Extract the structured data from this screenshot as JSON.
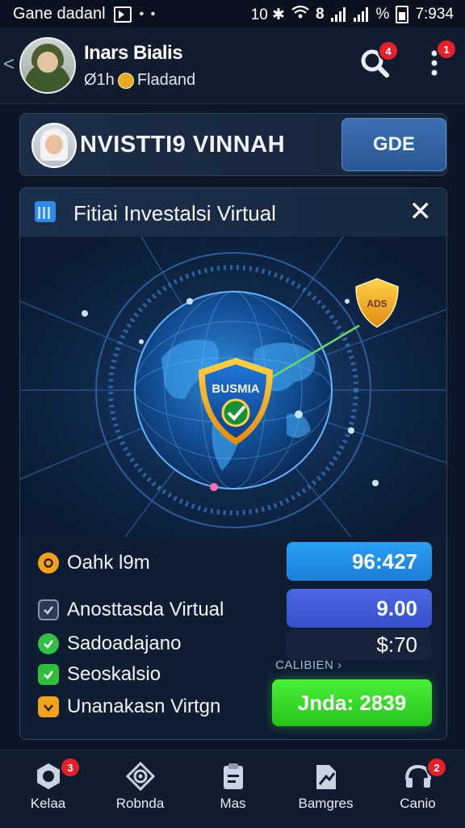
{
  "status_bar": {
    "left_text": "Gane dadanl",
    "dots": "• •",
    "indicators": "10 ✱",
    "net_label": "8",
    "percent": "%",
    "time": "7:934"
  },
  "header": {
    "user_name": "Inars Bialis",
    "user_sub_prefix": "Ø1h",
    "user_sub": "Fladand",
    "search_badge": "4",
    "menu_badge": "1"
  },
  "profile_card": {
    "title": "NVISTTI9 VINNAH",
    "button": "GDE"
  },
  "panel": {
    "title": "Fitiai Investalsi Virtual",
    "close_label": "✕",
    "shield_label": "BUSMIA",
    "small_shield_label": "ADS"
  },
  "rows": [
    {
      "label": "Oahk l9m",
      "icon": "coin-icon",
      "icon_color": "#f0a21f"
    },
    {
      "label": "Anosttasda Virtual",
      "icon": "checkbox-icon",
      "icon_color": "#8a94a8"
    },
    {
      "label": "Sadoadajano",
      "icon": "check-circle-icon",
      "icon_color": "#31c046"
    },
    {
      "label": "Seoskalsio",
      "icon": "check-box-icon",
      "icon_color": "#2fbf3a"
    },
    {
      "label": "Unanakasn Virtgn",
      "icon": "orange-check-icon",
      "icon_color": "#f0a21f"
    }
  ],
  "values": [
    {
      "text": "96:427",
      "color": "#1e8ee8"
    },
    {
      "text": "9.00",
      "color": "#3f58d6"
    },
    {
      "text": "$:70",
      "color": "#17233b"
    }
  ],
  "caption": "CALIBIEN",
  "cta_label": "Jnda: 2839",
  "bottom_nav": [
    {
      "label": "Kelaa",
      "icon": "hex-nut-icon",
      "badge": "3"
    },
    {
      "label": "Robnda",
      "icon": "target-icon",
      "badge": ""
    },
    {
      "label": "Mas",
      "icon": "clipboard-icon",
      "badge": ""
    },
    {
      "label": "Bamgres",
      "icon": "arrow-chart-icon",
      "badge": ""
    },
    {
      "label": "Canio",
      "icon": "headset-icon",
      "badge": "2"
    }
  ]
}
